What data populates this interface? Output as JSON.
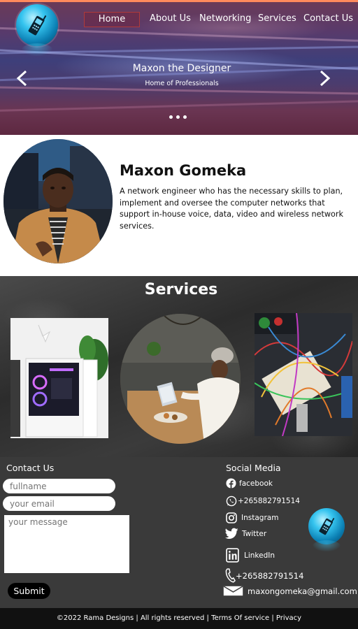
{
  "nav": {
    "items": [
      "Home",
      "About Us",
      "Networking",
      "Services",
      "Contact Us"
    ],
    "active": "Home"
  },
  "hero": {
    "title": "Maxon the Designer",
    "subtitle": "Home of Professionals",
    "prev_icon": "chevron-left-icon",
    "next_icon": "chevron-right-icon",
    "slide_count": 3
  },
  "profile": {
    "name": "Maxon Gomeka",
    "description": "A network engineer who has the necessary skills to plan, implement and oversee the computer networks that support in-house voice, data, video and wireless network services."
  },
  "services": {
    "title": "Services"
  },
  "contact": {
    "title": "Contact Us",
    "fullname_placeholder": "fullname",
    "email_placeholder": "your email",
    "message_placeholder": "your message",
    "submit_label": "Submit"
  },
  "social": {
    "title": "Social Media",
    "facebook": "facebook",
    "whatsapp": "+265882791514",
    "instagram": "Instagram",
    "twitter": "Twitter",
    "linkedin": "LinkedIn",
    "phone": "+265882791514",
    "email": "maxongomeka@gmail.com"
  },
  "footer": {
    "copyright": "©2022 Rama Designs",
    "rights": "All rights reserved",
    "terms": "Terms Of service",
    "privacy": "Privacy"
  },
  "colors": {
    "accent_top_bar": "#ff8a5c",
    "logo_blue": "#35c4ef",
    "contact_bg": "#3a3a3a",
    "footer_bg": "#111111"
  }
}
